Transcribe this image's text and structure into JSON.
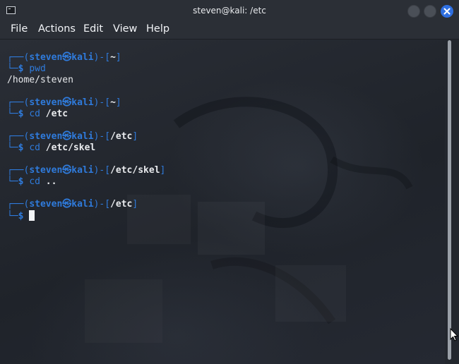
{
  "window": {
    "title": "steven@kali: /etc"
  },
  "menu": {
    "file": "File",
    "actions": "Actions",
    "edit": "Edit",
    "view": "View",
    "help": "Help"
  },
  "terminal": {
    "prompt_user_host": "steven㉿kali",
    "blocks": [
      {
        "cwd": "~",
        "command": "pwd",
        "arg": "",
        "output": "/home/steven"
      },
      {
        "cwd": "~",
        "command": "cd",
        "arg": "/etc",
        "output": ""
      },
      {
        "cwd": "/etc",
        "command": "cd",
        "arg": "/etc/skel",
        "output": ""
      },
      {
        "cwd": "/etc/skel",
        "command": "cd",
        "arg": "..",
        "output": ""
      },
      {
        "cwd": "/etc",
        "command": "",
        "arg": "",
        "output": ""
      }
    ]
  }
}
